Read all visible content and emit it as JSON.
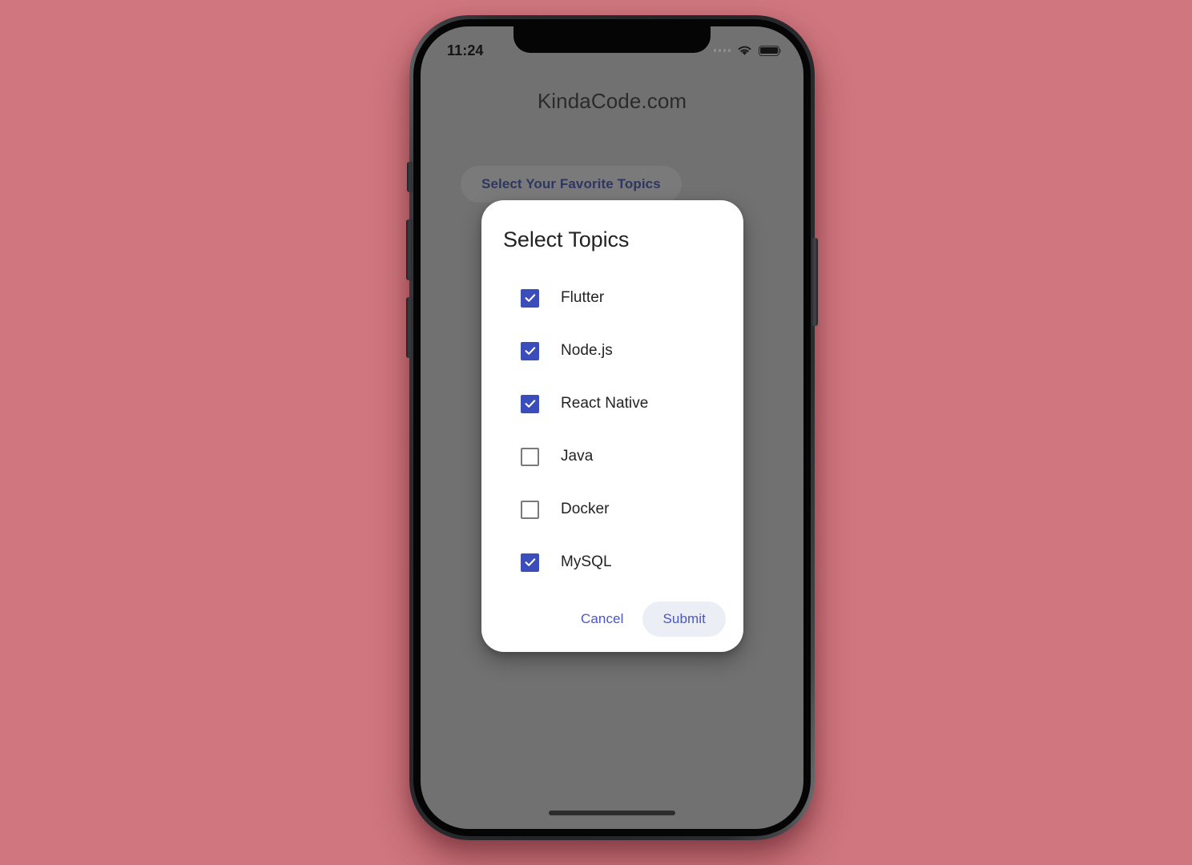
{
  "page": {
    "background_color": "#cf767e"
  },
  "device": {
    "kind": "iphone-mockup",
    "screen_overlay_color": "#717171"
  },
  "status_bar": {
    "time": "11:24",
    "cellular_icon": "cellular-signal-icon",
    "wifi_icon": "wifi-icon",
    "battery_icon": "battery-full-icon"
  },
  "app": {
    "title": "KindaCode.com",
    "favorite_topics_button_label": "Select Your Favorite Topics",
    "button_text_color": "#2f3661"
  },
  "dialog": {
    "title": "Select Topics",
    "checkbox_checked_color": "#3b4dba",
    "checkbox_unchecked_color": "#7a7a7d",
    "action_text_color": "#4a56c6",
    "submit_button_background": "#eceef5",
    "topics": [
      {
        "label": "Flutter",
        "checked": true
      },
      {
        "label": "Node.js",
        "checked": true
      },
      {
        "label": "React Native",
        "checked": true
      },
      {
        "label": "Java",
        "checked": false
      },
      {
        "label": "Docker",
        "checked": false
      },
      {
        "label": "MySQL",
        "checked": true
      }
    ],
    "cancel_label": "Cancel",
    "submit_label": "Submit"
  }
}
